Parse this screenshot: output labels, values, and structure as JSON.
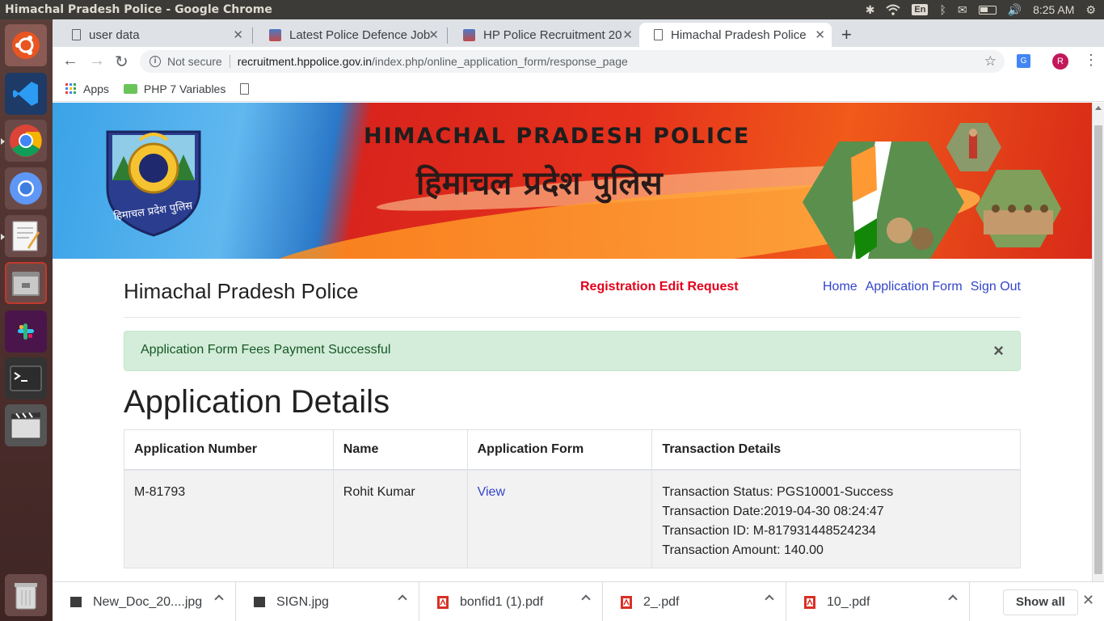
{
  "os": {
    "window_title": "Himachal Pradesh Police - Google Chrome",
    "keyboard_layout": "En",
    "clock": "8:25 AM"
  },
  "browser": {
    "tabs": [
      {
        "title": "user data"
      },
      {
        "title": "Latest Police Defence Job"
      },
      {
        "title": "HP Police Recruitment 20"
      },
      {
        "title": "Himachal Pradesh Police"
      }
    ],
    "address": {
      "security_label": "Not secure",
      "host": "recruitment.hppolice.gov.in",
      "path": "/index.php/online_application_form/response_page"
    },
    "profile_initial": "R",
    "bookmarks": [
      {
        "label": "Apps"
      },
      {
        "label": "PHP 7 Variables"
      }
    ]
  },
  "banner": {
    "title_en": "HIMACHAL PRADESH POLICE",
    "title_hi": "हिमाचल प्रदेश पुलिस",
    "emblem_text": "हिमाचल प्रदेश पुलिस"
  },
  "navbar": {
    "brand": "Himachal Pradesh Police",
    "edit_request": "Registration Edit Request",
    "links": [
      "Home",
      "Application Form",
      "Sign Out"
    ]
  },
  "alert": {
    "message": "Application Form Fees Payment Successful",
    "close": "×"
  },
  "main": {
    "heading": "Application Details",
    "table": {
      "headers": [
        "Application Number",
        "Name",
        "Application Form",
        "Transaction Details"
      ],
      "rows": [
        {
          "application_number": "M-81793",
          "name": "Rohit Kumar",
          "form_link": "View",
          "transaction": {
            "status": "Transaction Status: PGS10001-Success",
            "date": "Transaction Date:2019-04-30 08:24:47",
            "id": "Transaction ID: M-817931448524234",
            "amount": "Transaction Amount: 140.00"
          }
        }
      ]
    }
  },
  "downloads": {
    "items": [
      {
        "name": "New_Doc_20....jpg",
        "type": "image"
      },
      {
        "name": "SIGN.jpg",
        "type": "image"
      },
      {
        "name": "bonfid1 (1).pdf",
        "type": "pdf"
      },
      {
        "name": "2_.pdf",
        "type": "pdf"
      },
      {
        "name": "10_.pdf",
        "type": "pdf"
      }
    ],
    "show_all": "Show all"
  },
  "colors": {
    "alert_bg": "#d4edda",
    "alert_text": "#155724",
    "link": "#3344cc",
    "edit_request": "#e3001b"
  }
}
